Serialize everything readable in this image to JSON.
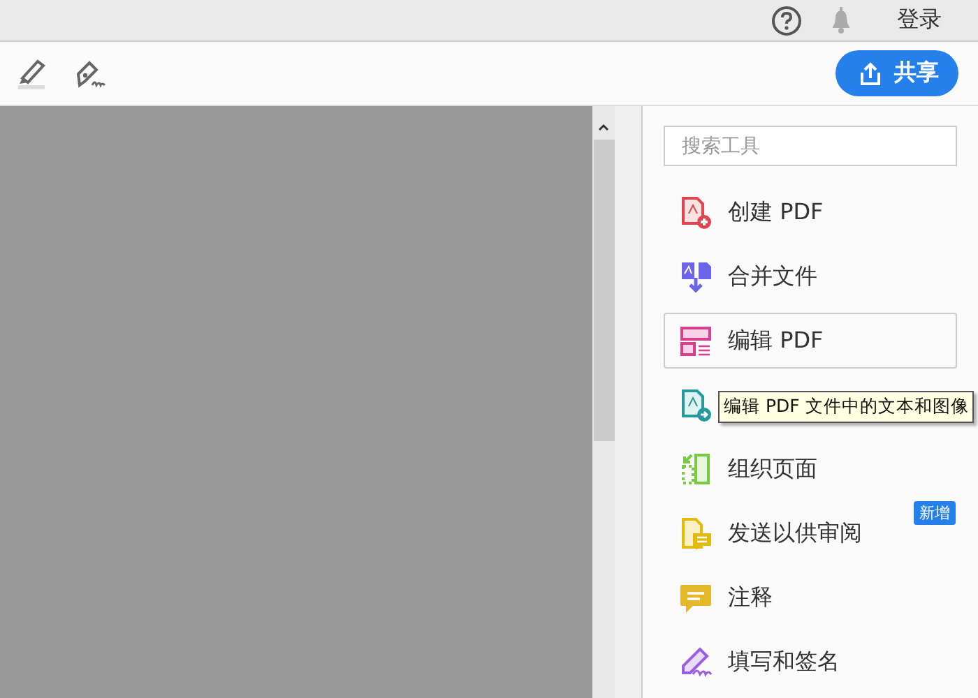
{
  "top_bar": {
    "login": "登录"
  },
  "toolbar": {
    "share_button": "共享"
  },
  "tools_panel": {
    "search": {
      "placeholder": "搜索工具"
    },
    "items": [
      {
        "kind": "create",
        "label": "创建 PDF",
        "color": "#e0454f",
        "selected": false
      },
      {
        "kind": "combine",
        "label": "合并文件",
        "color": "#6b63e8",
        "selected": false
      },
      {
        "kind": "edit",
        "label": "编辑 PDF",
        "color": "#d6408e",
        "selected": true
      },
      {
        "kind": "export",
        "color": "#26999b",
        "selected": false
      },
      {
        "kind": "organize",
        "label": "组织页面",
        "color": "#7ac943",
        "selected": false
      },
      {
        "kind": "review",
        "label": "发送以供审阅",
        "color": "#e3b90d",
        "selected": false,
        "badge": "新增"
      },
      {
        "kind": "comment",
        "label": "注释",
        "color": "#e3b92b",
        "selected": false
      },
      {
        "kind": "sign",
        "label": "填写和签名",
        "color": "#9b5ee0",
        "selected": false
      }
    ],
    "tooltip": "编辑 PDF 文件中的文本和图像"
  }
}
